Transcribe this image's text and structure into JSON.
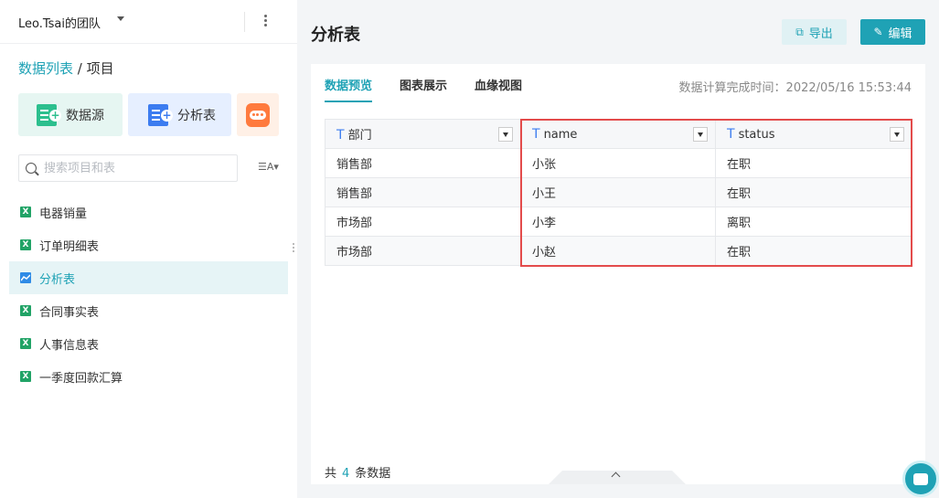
{
  "team": {
    "name": "Leo.Tsai的团队"
  },
  "breadcrumb": {
    "link": "数据列表",
    "separator": " / ",
    "current": "项目"
  },
  "actions": {
    "data_source": "数据源",
    "analysis": "分析表"
  },
  "search": {
    "placeholder": "搜索项目和表"
  },
  "sidebar": {
    "items": [
      {
        "label": "电器销量",
        "icon": "excel-icon"
      },
      {
        "label": "订单明细表",
        "icon": "excel-icon"
      },
      {
        "label": "分析表",
        "icon": "chart-line-icon",
        "active": true
      },
      {
        "label": "合同事实表",
        "icon": "excel-icon"
      },
      {
        "label": "人事信息表",
        "icon": "excel-icon"
      },
      {
        "label": "一季度回款汇算",
        "icon": "excel-icon"
      }
    ]
  },
  "header": {
    "title": "分析表",
    "export_label": "导出",
    "edit_label": "编辑"
  },
  "tabs": [
    "数据预览",
    "图表展示",
    "血缘视图"
  ],
  "calc_time": "数据计算完成时间：2022/05/16 15:53:44",
  "table": {
    "type_glyph": "T",
    "columns": [
      "部门",
      "name",
      "status"
    ],
    "rows": [
      [
        "销售部",
        "小张",
        "在职"
      ],
      [
        "销售部",
        "小王",
        "在职"
      ],
      [
        "市场部",
        "小李",
        "离职"
      ],
      [
        "市场部",
        "小赵",
        "在职"
      ]
    ]
  },
  "footer": {
    "prefix": "共",
    "count": "4",
    "suffix": "条数据"
  },
  "colors": {
    "accent": "#1fa2b5",
    "highlight": "#e34b4b",
    "excel": "#21a366"
  }
}
